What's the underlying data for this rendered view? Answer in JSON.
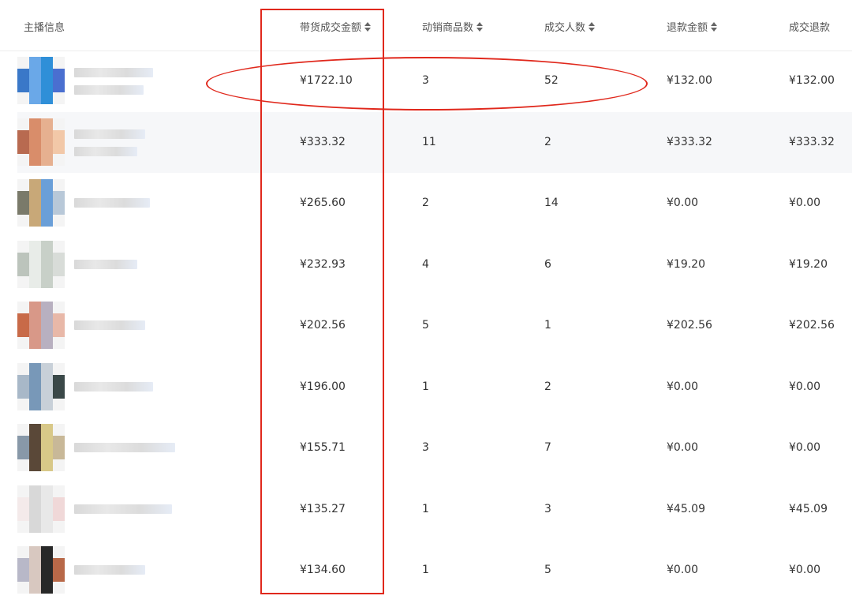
{
  "table": {
    "headers": {
      "anchor": "主播信息",
      "gmv": "带货成交金额",
      "products": "动销商品数",
      "buyers": "成交人数",
      "refund": "退款金额",
      "deal_refund": "成交退款"
    },
    "rows": [
      {
        "gmv": "¥1722.10",
        "products": "3",
        "buyers": "52",
        "refund": "¥132.00",
        "deal_refund": "¥132.00"
      },
      {
        "gmv": "¥333.32",
        "products": "11",
        "buyers": "2",
        "refund": "¥333.32",
        "deal_refund": "¥333.32"
      },
      {
        "gmv": "¥265.60",
        "products": "2",
        "buyers": "14",
        "refund": "¥0.00",
        "deal_refund": "¥0.00"
      },
      {
        "gmv": "¥232.93",
        "products": "4",
        "buyers": "6",
        "refund": "¥19.20",
        "deal_refund": "¥19.20"
      },
      {
        "gmv": "¥202.56",
        "products": "5",
        "buyers": "1",
        "refund": "¥202.56",
        "deal_refund": "¥202.56"
      },
      {
        "gmv": "¥196.00",
        "products": "1",
        "buyers": "2",
        "refund": "¥0.00",
        "deal_refund": "¥0.00"
      },
      {
        "gmv": "¥155.71",
        "products": "3",
        "buyers": "7",
        "refund": "¥0.00",
        "deal_refund": "¥0.00"
      },
      {
        "gmv": "¥135.27",
        "products": "1",
        "buyers": "3",
        "refund": "¥45.09",
        "deal_refund": "¥45.09"
      },
      {
        "gmv": "¥134.60",
        "products": "1",
        "buyers": "5",
        "refund": "¥0.00",
        "deal_refund": "¥0.00"
      }
    ]
  },
  "icons": {
    "sort": "sort-icon"
  },
  "colors": {
    "annotation": "#e0281c",
    "row_alt": "#f6f7f9"
  }
}
